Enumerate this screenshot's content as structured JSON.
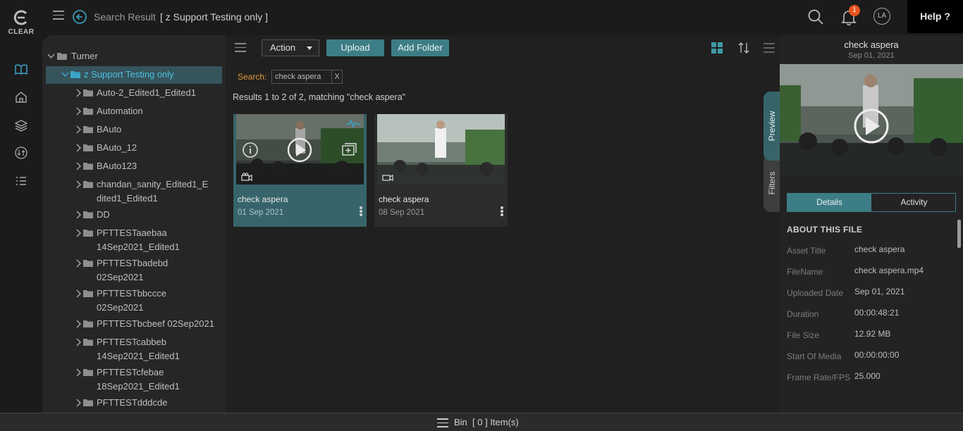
{
  "logo": {
    "text": "CLEAR"
  },
  "header": {
    "breadcrumb_prefix": "Search Result",
    "breadcrumb_current": "[ z Support Testing only ]",
    "notification_count": "1",
    "avatar_initials": "LA",
    "help_label": "Help ?"
  },
  "tree": {
    "root": "Turner",
    "selected": "z Support Testing only",
    "items": [
      {
        "label": "Auto-2_Edited1_Edited1"
      },
      {
        "label": "Automation"
      },
      {
        "label": "BAuto"
      },
      {
        "label": "BAuto_12"
      },
      {
        "label": "BAuto123"
      },
      {
        "label": "chandan_sanity_Edited1_E",
        "label2": "dited1_Edited1"
      },
      {
        "label": "DD"
      },
      {
        "label": "PFTTESTaaebaa",
        "label2": "14Sep2021_Edited1"
      },
      {
        "label": "PFTTESTbadebd",
        "label2": "02Sep2021"
      },
      {
        "label": "PFTTESTbbccce",
        "label2": "02Sep2021"
      },
      {
        "label": "PFTTESTbcbeef 02Sep2021"
      },
      {
        "label": "PFTTESTcabbeb",
        "label2": "14Sep2021_Edited1"
      },
      {
        "label": "PFTTESTcfebae",
        "label2": "18Sep2021_Edited1"
      },
      {
        "label": "PFTTESTdddcde"
      }
    ]
  },
  "toolbar": {
    "action_label": "Action",
    "upload_label": "Upload",
    "add_folder_label": "Add Folder"
  },
  "search": {
    "label": "Search:",
    "term": "check aspera",
    "clear": "X",
    "results_text": "Results 1 to 2 of 2, matching \"check aspera\""
  },
  "assets": [
    {
      "title": "check aspera",
      "date": "01 Sep 2021"
    },
    {
      "title": "check aspera",
      "date": "08 Sep 2021"
    }
  ],
  "side_tabs": {
    "preview": "Preview",
    "filters": "Filters"
  },
  "panel": {
    "title": "check aspera",
    "date": "Sep 01, 2021",
    "tab_details": "Details",
    "tab_activity": "Activity",
    "about": "ABOUT THIS FILE",
    "fields": [
      {
        "k": "Asset Title",
        "v": "check aspera"
      },
      {
        "k": "FileName",
        "v": "check aspera.mp4"
      },
      {
        "k": "Uploaded Date",
        "v": "Sep 01, 2021"
      },
      {
        "k": "Duration",
        "v": "00:00:48:21"
      },
      {
        "k": "File Size",
        "v": "12.92 MB"
      },
      {
        "k": "Start Of Media",
        "v": "00:00:00:00"
      },
      {
        "k": "Frame Rate/FPS",
        "v": "25.000"
      }
    ]
  },
  "bin": {
    "label": "Bin",
    "count_text": "[ 0 ] Item(s)"
  },
  "colors": {
    "accent": "#3d7d85",
    "selected_tree": "#36545c",
    "search_label": "#e09a3a",
    "badge": "#e8531e"
  }
}
